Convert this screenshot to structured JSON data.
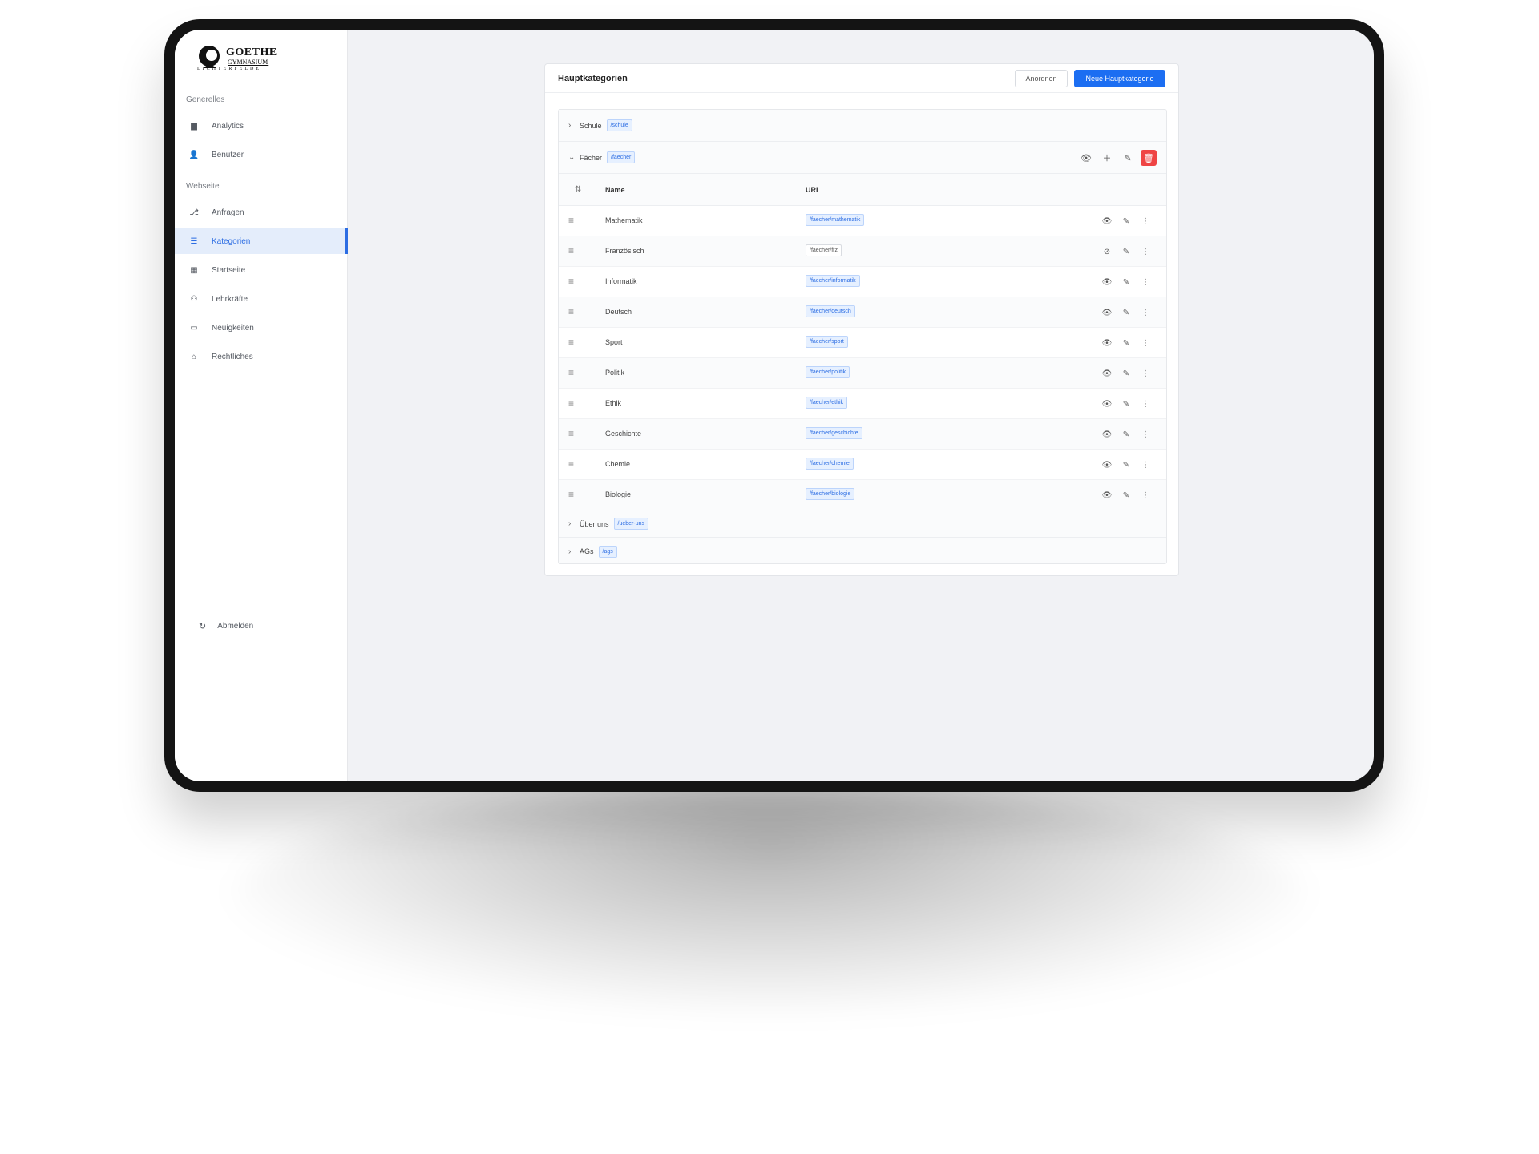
{
  "sidebar": {
    "logo": {
      "title": "GOETHE",
      "subtitle": "GYMNASIUM",
      "subline": "LICHTERFELDE"
    },
    "sections": [
      {
        "label": "Generelles"
      },
      {
        "label": "Webseite"
      }
    ],
    "items": [
      {
        "label": "Analytics",
        "icon": "bar-chart-icon"
      },
      {
        "label": "Benutzer",
        "icon": "user-icon"
      },
      {
        "label": "Anfragen",
        "icon": "inbox-icon"
      },
      {
        "label": "Kategorien",
        "icon": "list-icon",
        "active": true
      },
      {
        "label": "Startseite",
        "icon": "grid-icon"
      },
      {
        "label": "Lehrkräfte",
        "icon": "users-icon"
      },
      {
        "label": "Neuigkeiten",
        "icon": "calendar-icon"
      },
      {
        "label": "Rechtliches",
        "icon": "bank-icon"
      }
    ],
    "logout_label": "Abmelden"
  },
  "main": {
    "title": "Hauptkategorien",
    "arrange_label": "Anordnen",
    "new_label": "Neue Hauptkategorie",
    "categories": [
      {
        "name": "Schule",
        "url": "/schule",
        "expanded": false
      },
      {
        "name": "Fächer",
        "url": "/faecher",
        "expanded": true
      },
      {
        "name": "Über uns",
        "url": "/ueber-uns",
        "expanded": false
      },
      {
        "name": "AGs",
        "url": "/ags",
        "expanded": false
      }
    ],
    "columns": {
      "name": "Name",
      "url": "URL"
    },
    "subcategories": [
      {
        "name": "Mathematik",
        "url": "/faecher/mathematik",
        "visible": true
      },
      {
        "name": "Französisch",
        "url": "/faecher/frz",
        "visible": false
      },
      {
        "name": "Informatik",
        "url": "/faecher/informatik",
        "visible": true
      },
      {
        "name": "Deutsch",
        "url": "/faecher/deutsch",
        "visible": true
      },
      {
        "name": "Sport",
        "url": "/faecher/sport",
        "visible": true
      },
      {
        "name": "Politik",
        "url": "/faecher/politik",
        "visible": true
      },
      {
        "name": "Ethik",
        "url": "/faecher/ethik",
        "visible": true
      },
      {
        "name": "Geschichte",
        "url": "/faecher/geschichte",
        "visible": true
      },
      {
        "name": "Chemie",
        "url": "/faecher/chemie",
        "visible": true
      },
      {
        "name": "Biologie",
        "url": "/faecher/biologie",
        "visible": true
      }
    ]
  },
  "colors": {
    "accent": "#1c6ef2",
    "danger": "#ef4444",
    "active_bg": "#e4edfb"
  }
}
